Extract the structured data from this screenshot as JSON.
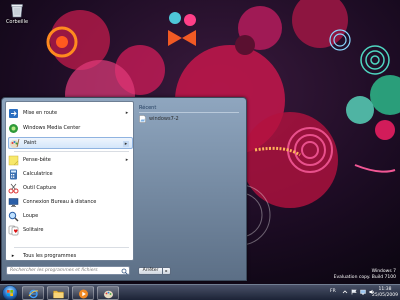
{
  "desktop": {
    "recycle_bin_label": "Corbeille",
    "watermark_line1": "Windows 7",
    "watermark_line2": "Evaluation copy. Build 7100"
  },
  "start_menu": {
    "programs": [
      {
        "label": "Mise en route",
        "icon": "getting-started-icon",
        "has_arrow": true
      },
      {
        "label": "Windows Media Center",
        "icon": "media-center-icon",
        "has_arrow": false
      },
      {
        "label": "Paint",
        "icon": "paint-icon",
        "has_arrow": true,
        "selected": true
      },
      {
        "label": "Pense-bête",
        "icon": "sticky-notes-icon",
        "has_arrow": true
      },
      {
        "label": "Calculatrice",
        "icon": "calculator-icon",
        "has_arrow": false
      },
      {
        "label": "Outil Capture",
        "icon": "snipping-tool-icon",
        "has_arrow": false
      },
      {
        "label": "Connexion Bureau à distance",
        "icon": "remote-desktop-icon",
        "has_arrow": false
      },
      {
        "label": "Loupe",
        "icon": "magnifier-icon",
        "has_arrow": false
      },
      {
        "label": "Solitaire",
        "icon": "solitaire-icon",
        "has_arrow": false
      }
    ],
    "all_programs_label": "Tous les programmes",
    "search_placeholder": "Rechercher les programmes et fichiers",
    "shutdown_label": "Arrêter",
    "shutdown_arrow": "▸",
    "recent": {
      "title": "Récent",
      "items": [
        "windows7-2"
      ]
    }
  },
  "taskbar": {
    "language": "FR",
    "time": "11:38",
    "date": "25/05/2009",
    "pinned": [
      "internet-explorer-icon",
      "explorer-folder-icon",
      "media-player-icon",
      "paint-icon"
    ]
  },
  "colors": {
    "accent": "#8fb3e0",
    "wallpaper_base": "#1a0b22"
  }
}
